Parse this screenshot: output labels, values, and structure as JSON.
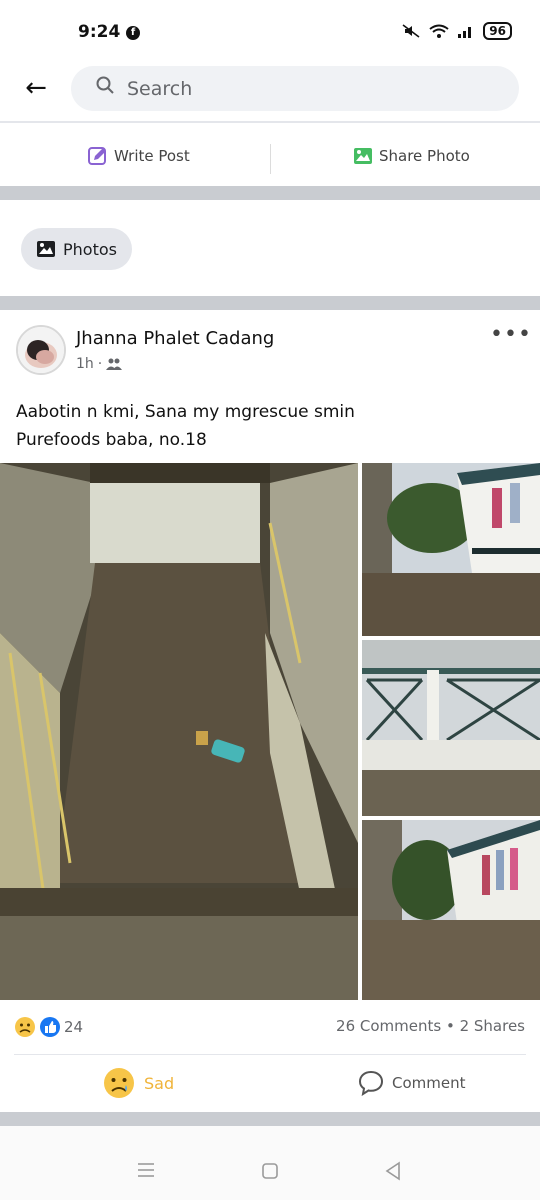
{
  "status_bar": {
    "time": "9:24",
    "fb_badge": "f",
    "battery": "96"
  },
  "search": {
    "placeholder": "Search"
  },
  "actions": {
    "write_post": "Write Post",
    "share_photo": "Share Photo"
  },
  "photos_chip": {
    "label": "Photos"
  },
  "post": {
    "author": "Jhanna Phalet Cadang",
    "time": "1h",
    "privacy_icon": "friends-icon",
    "text": "Aabotin n kmi,  Sana my mgrescue smin\nPurefoods baba, no.18",
    "reaction_count": "24",
    "stats": "26 Comments • 2 Shares"
  },
  "buttons": {
    "sad": "Sad",
    "comment": "Comment"
  },
  "colors": {
    "accent": "#1877f2",
    "sad": "#f0b43a",
    "separator": "#c9ccd1",
    "search_bg": "#f0f2f5"
  }
}
